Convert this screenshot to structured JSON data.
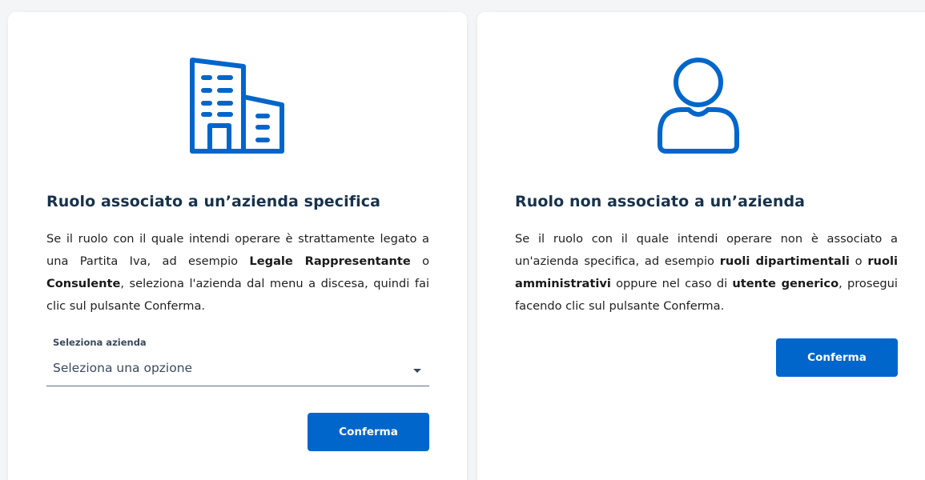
{
  "colors": {
    "primary": "#0066cc",
    "title": "#17324d",
    "background": "#f4f5f7",
    "card": "#ffffff"
  },
  "company_card": {
    "icon": "building-icon",
    "title": "Ruolo associato a un’azienda specifica",
    "desc_1": "Se il ruolo con il quale intendi operare è strattamente legato a una Partita Iva, ad esempio ",
    "desc_b1": "Legale Rappresentante",
    "desc_2": " o ",
    "desc_b2": "Consulente",
    "desc_3": ", seleziona l'azienda dal menu a discesa, quindi fai clic sul pulsante Conferma.",
    "select_label": "Seleziona azienda",
    "select_value": "Seleziona una opzione",
    "confirm_label": "Conferma"
  },
  "generic_card": {
    "icon": "user-icon",
    "title": "Ruolo non associato a un’azienda",
    "desc_1": "Se il ruolo con il quale intendi operare non è associato a un'azienda specifica, ad esempio ",
    "desc_b1": "ruoli dipartimentali",
    "desc_2": " o ",
    "desc_b2": "ruoli amministrativi",
    "desc_3": " oppure nel caso di ",
    "desc_b3": "utente generico",
    "desc_4": ", prosegui facendo clic sul pulsante Conferma.",
    "confirm_label": "Conferma"
  }
}
